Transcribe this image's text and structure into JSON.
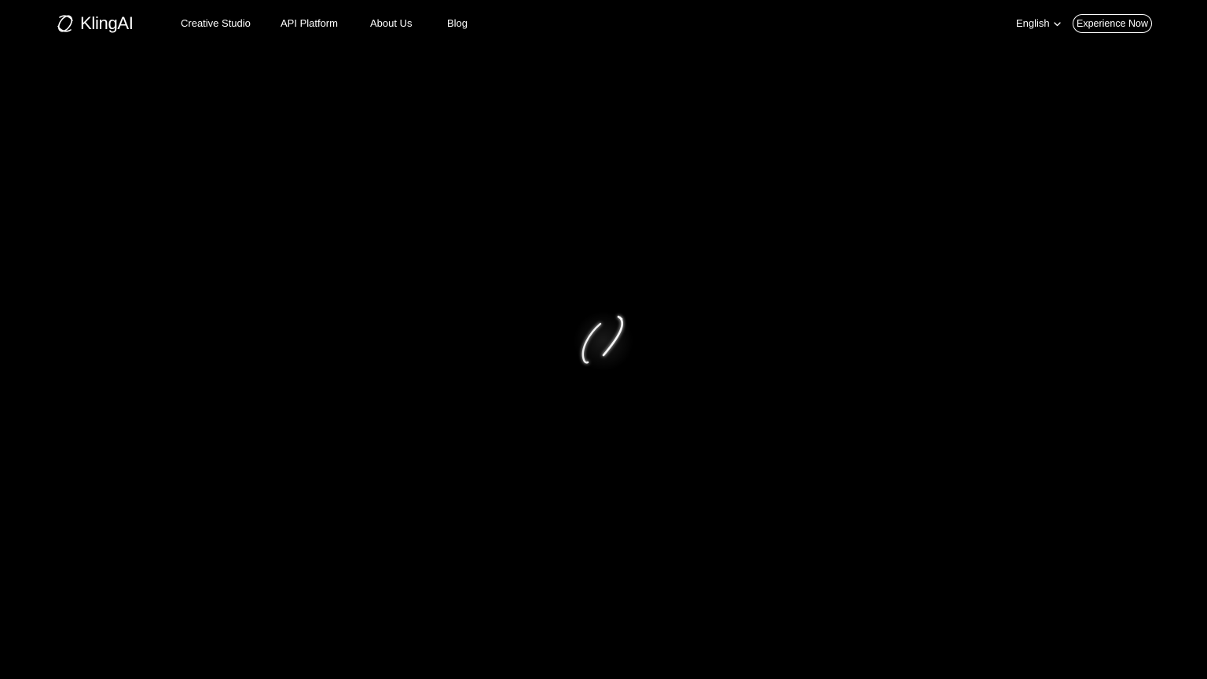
{
  "header": {
    "logo": {
      "text": "KlingAI",
      "icon": "kling-logo-icon"
    },
    "nav": [
      {
        "label": "Creative Studio"
      },
      {
        "label": "API Platform"
      },
      {
        "label": "About Us"
      },
      {
        "label": "Blog"
      }
    ],
    "language": {
      "label": "English",
      "icon": "chevron-down-icon"
    },
    "cta": {
      "label": "Experience Now"
    }
  },
  "main": {
    "loader": {
      "icon": "loading-spinner-icon"
    }
  },
  "colors": {
    "background": "#000000",
    "text": "#ffffff"
  }
}
